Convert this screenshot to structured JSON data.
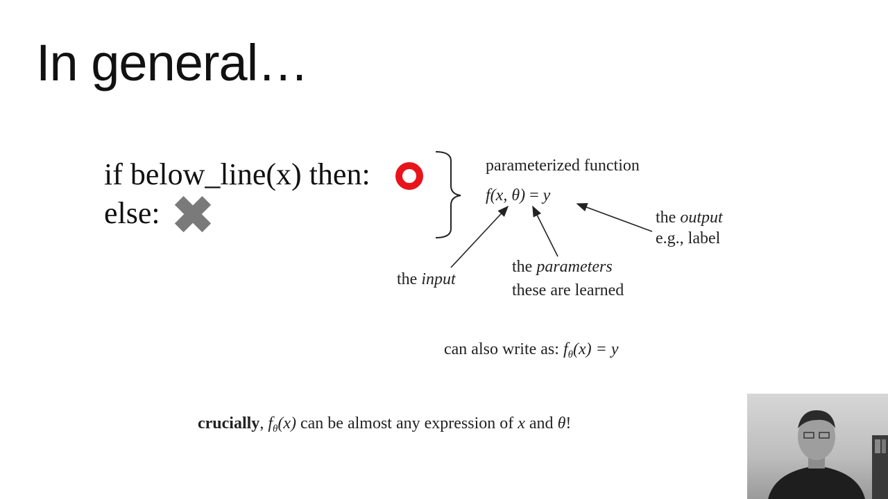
{
  "slide": {
    "title": "In general…",
    "condition": {
      "if_prefix": "if below_line(x) then:",
      "else_prefix": "else:",
      "then_icon": "red-circle-icon",
      "else_icon": "gray-x-icon",
      "colors": {
        "circle": "#e8141c",
        "cross": "#7a7a7a"
      }
    },
    "annotations": {
      "parameterized_function": "parameterized function",
      "equation_f": "f",
      "equation_args": "(x, θ)",
      "equation_eq": " = ",
      "equation_y": "y",
      "output_the": "the ",
      "output_word": "output",
      "output_eg": "e.g., label",
      "input_the": "the ",
      "input_word": "input",
      "params_the": "the ",
      "params_word": "parameters",
      "params_learned": "these are learned"
    },
    "alt_form": {
      "prefix": "can also write as:",
      "f": "f",
      "sub": "θ",
      "rest": "(x) = y"
    },
    "crucially": {
      "bold": "crucially",
      "comma": ", ",
      "f": "f",
      "sub": "θ",
      "x": "(x)",
      "text": " can be almost any expression of ",
      "x_var": "x",
      "and": " and ",
      "theta": "θ",
      "bang": "!"
    },
    "webcam": {
      "icon": "presenter-webcam"
    }
  }
}
